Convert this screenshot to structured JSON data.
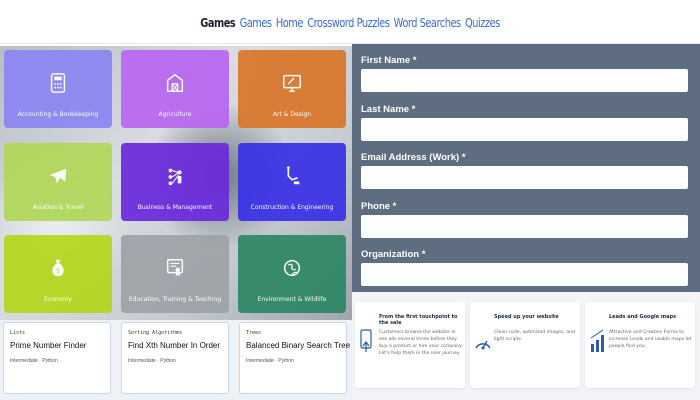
{
  "nav": {
    "brand": "Games",
    "items": [
      "Games",
      "Home",
      "Crossword Puzzles",
      "Word Searches",
      "Quizzes"
    ]
  },
  "tiles": [
    {
      "label": "Accounting & Bookkeeping",
      "icon": "calculator-icon",
      "color": "#8b86f2"
    },
    {
      "label": "Agriculture",
      "icon": "barn-icon",
      "color": "#b867f2"
    },
    {
      "label": "Art & Design",
      "icon": "monitor-icon",
      "color": "#d9762c"
    },
    {
      "label": "Aviation & Travel",
      "icon": "airplane-icon",
      "color": "#b1d859"
    },
    {
      "label": "Business & Management",
      "icon": "people-network-icon",
      "color": "#6a2bdc"
    },
    {
      "label": "Construction & Engineering",
      "icon": "crane-icon",
      "color": "#3a31e6"
    },
    {
      "label": "Economy",
      "icon": "money-bag-icon",
      "color": "#b3d71c"
    },
    {
      "label": "Education, Training & Teaching",
      "icon": "certificate-icon",
      "color": "#9ea3a8"
    },
    {
      "label": "Environment & Wildlife",
      "icon": "globe-leaf-icon",
      "color": "#2e8764"
    }
  ],
  "cards": [
    {
      "category": "Lists",
      "title": "Prime Number Finder",
      "meta": "Intermediate · Python"
    },
    {
      "category": "Sorting Algorithms",
      "title": "Find Xth Number In Order",
      "meta": "Intermediate · Python"
    },
    {
      "category": "Trees",
      "title": "Balanced Binary Search Tree",
      "meta": "Intermediate · Python"
    }
  ],
  "form": {
    "fields": [
      {
        "label": "First Name *",
        "value": ""
      },
      {
        "label": "Last Name *",
        "value": ""
      },
      {
        "label": "Email Address (Work) *",
        "value": ""
      },
      {
        "label": "Phone *",
        "value": ""
      },
      {
        "label": "Organization *",
        "value": ""
      }
    ]
  },
  "features": [
    {
      "title": "From the first touchpoint to the sale",
      "desc": "Customers browse the website or see ads several times before they buy a product or hire your company. Let's help them in the user journey.",
      "icon": "touchpoint-icon"
    },
    {
      "title": "Speed up your website",
      "desc": "Clean code, optimized images, and light scripts.",
      "icon": "speed-icon"
    },
    {
      "title": "Leads and Google maps",
      "desc": "Attractive and Creative Forms to increase Leads and usable maps let people find you.",
      "icon": "chart-icon"
    }
  ]
}
